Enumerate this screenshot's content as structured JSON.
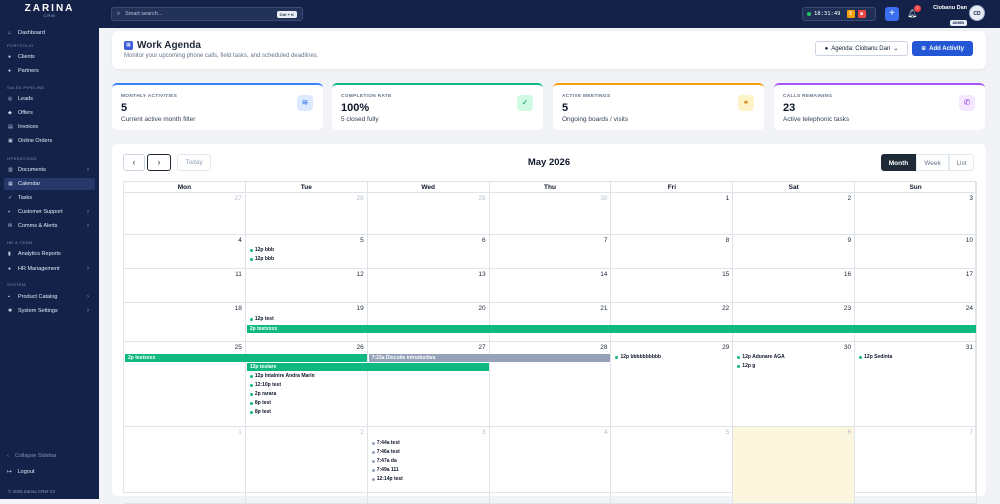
{
  "app": {
    "logo": "ZARINA",
    "logo_sub": "CRM"
  },
  "sidebar": {
    "sections": [
      "PORTFOLIO",
      "SALES PIPELINE",
      "OPERATIONS",
      "HR & TEAM",
      "SYSTEM"
    ],
    "items": [
      {
        "label": "Dashboard",
        "icon": "home-icon"
      },
      {
        "label": "Clients",
        "icon": "user-icon"
      },
      {
        "label": "Partners",
        "icon": "users-icon"
      },
      {
        "label": "Leads",
        "icon": "target-icon"
      },
      {
        "label": "Offers",
        "icon": "tag-icon"
      },
      {
        "label": "Invoices",
        "icon": "file-invoice-icon"
      },
      {
        "label": "Online Orders",
        "icon": "cart-icon"
      },
      {
        "label": "Documents",
        "icon": "document-icon"
      },
      {
        "label": "Calendar",
        "icon": "calendar-icon"
      },
      {
        "label": "Tasks",
        "icon": "check-icon"
      },
      {
        "label": "Customer Support",
        "icon": "headset-icon"
      },
      {
        "label": "Comms & Alerts",
        "icon": "chat-icon"
      },
      {
        "label": "Analytics Reports",
        "icon": "chart-icon"
      },
      {
        "label": "HR Management",
        "icon": "team-icon"
      },
      {
        "label": "Product Catalog",
        "icon": "box-icon"
      },
      {
        "label": "System Settings",
        "icon": "gear-icon"
      }
    ],
    "collapse_label": "Collapse Sidebar",
    "logout_label": "Logout",
    "copyright": "© 2026 Zarina CRM V3"
  },
  "topbar": {
    "search_placeholder": "Smart search...",
    "search_shortcut": "Ctrl + K",
    "clock": "18:31:49",
    "notification_count": "0",
    "user_name": "Ciobanu Dan",
    "user_role": "ADMIN",
    "user_initials": "CD"
  },
  "header": {
    "title": "Work Agenda",
    "subtitle": "Monitor your upcoming phone calls, field tasks, and scheduled deadlines.",
    "agenda_select": "Agenda: Ciobanu Dan",
    "add_button": "Add Activity"
  },
  "stats": [
    {
      "label": "MONTHLY ACTIVITIES",
      "value": "5",
      "desc": "Current active month filter",
      "color": "#3b82f6",
      "icon": "layers-icon"
    },
    {
      "label": "COMPLETION RATE",
      "value": "100%",
      "desc": "5 closed fully",
      "color": "#10b981",
      "icon": "double-check-icon"
    },
    {
      "label": "ACTIVE MEETINGS",
      "value": "5",
      "desc": "Ongoing boards / visits",
      "color": "#f59e0b",
      "icon": "handshake-icon"
    },
    {
      "label": "CALLS REMAINING",
      "value": "23",
      "desc": "Active telephonic tasks",
      "color": "#a855f7",
      "icon": "phone-icon"
    }
  ],
  "calendar": {
    "today_label": "Today",
    "month_title": "May 2026",
    "views": [
      "Month",
      "Week",
      "List"
    ],
    "weekdays": [
      "Mon",
      "Tue",
      "Wed",
      "Thu",
      "Fri",
      "Sat",
      "Sun"
    ],
    "weeks": [
      [
        "27",
        "28",
        "29",
        "30",
        "1",
        "2",
        "3"
      ],
      [
        "4",
        "5",
        "6",
        "7",
        "8",
        "9",
        "10"
      ],
      [
        "11",
        "12",
        "13",
        "14",
        "15",
        "16",
        "17"
      ],
      [
        "18",
        "19",
        "20",
        "21",
        "22",
        "23",
        "24"
      ],
      [
        "25",
        "26",
        "27",
        "28",
        "29",
        "30",
        "31"
      ],
      [
        "1",
        "2",
        "3",
        "4",
        "5",
        "6",
        "7"
      ]
    ],
    "events": {
      "w1_tue": [
        "12p bbb",
        "12p bbb"
      ],
      "w3_tue": [
        "12p test"
      ],
      "w4_tue": [
        "12p Intalnire Andra Marin",
        "12:10p test",
        "2p rarara",
        "8p test",
        "8p test"
      ],
      "w4_fri": [
        "12p bbbbbbbbbb"
      ],
      "w4_sat": [
        "12p Adunare AGA",
        "12p g"
      ],
      "w4_sun": [
        "12p Sedinta"
      ],
      "w5_wed": [
        "7:44a test",
        "7:46a test",
        "7:47a da",
        "7:49a 111",
        "12:14p test"
      ]
    },
    "bars": {
      "w3_bar": "2p testxxxx",
      "w4_bar_mon": "2p testxxxx",
      "w4_bar_wed": "7:22a Discutie introductiva",
      "w4_bar_tue": "12p testare"
    }
  }
}
